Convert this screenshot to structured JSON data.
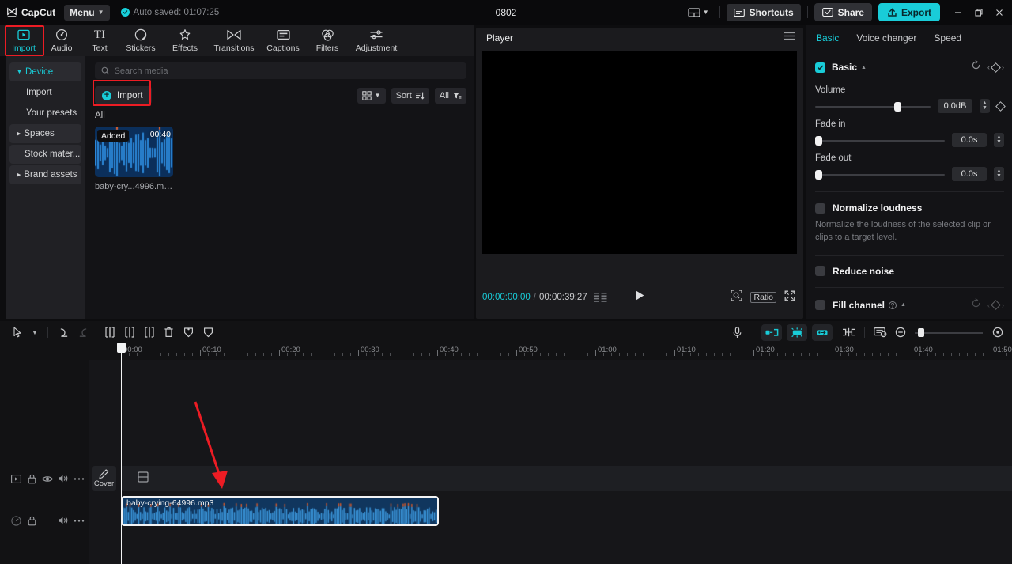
{
  "topbar": {
    "brand": "CapCut",
    "menu_label": "Menu",
    "autosave": "Auto saved: 01:07:25",
    "project_title": "0802",
    "shortcuts_label": "Shortcuts",
    "share_label": "Share",
    "export_label": "Export",
    "accent": "#19ccd8",
    "icons": {
      "layout": "layout-icon",
      "layout_caret": "chevron-down-icon",
      "shortcuts": "keyboard-icon",
      "share": "share-icon",
      "export": "upload-icon",
      "minimize": "minimize-icon",
      "maximize": "restore-icon",
      "close": "close-icon"
    }
  },
  "tabs": [
    {
      "label": "Import",
      "icon": "media-import-icon",
      "active": true
    },
    {
      "label": "Audio",
      "icon": "music-note-icon",
      "active": false
    },
    {
      "label": "Text",
      "icon": "text-icon",
      "active": false
    },
    {
      "label": "Stickers",
      "icon": "sticker-icon",
      "active": false
    },
    {
      "label": "Effects",
      "icon": "sparkle-icon",
      "active": false
    },
    {
      "label": "Transitions",
      "icon": "transition-icon",
      "active": false
    },
    {
      "label": "Captions",
      "icon": "caption-icon",
      "active": false
    },
    {
      "label": "Filters",
      "icon": "filters-icon",
      "active": false
    },
    {
      "label": "Adjustment",
      "icon": "adjustment-icon",
      "active": false
    }
  ],
  "leftnav": [
    {
      "label": "Device",
      "type": "group",
      "expanded": true,
      "active": true
    },
    {
      "label": "Import",
      "type": "sub",
      "active": false
    },
    {
      "label": "Your presets",
      "type": "sub",
      "active": false
    },
    {
      "label": "Spaces",
      "type": "group",
      "expanded": false,
      "active": false
    },
    {
      "label": "Stock mater...",
      "type": "plain",
      "active": false
    },
    {
      "label": "Brand assets",
      "type": "group",
      "expanded": false,
      "active": false
    }
  ],
  "media_panel": {
    "search_placeholder": "Search media",
    "search_value": "",
    "import_label": "Import",
    "view_chip": "grid-view",
    "sort_label": "Sort",
    "filter_label": "All",
    "all_label": "All",
    "items": [
      {
        "name": "baby-cry...4996.mp3",
        "badge": "Added",
        "duration": "00:40"
      }
    ]
  },
  "player": {
    "title": "Player",
    "current_time": "00:00:00:00",
    "separator": "/",
    "total_time": "00:00:39:27",
    "ratio_label": "Ratio",
    "icons": {
      "menu": "hamburger-icon",
      "quality": "quality-lines-icon",
      "play": "play-icon",
      "zoom_fit": "zoom-fit-icon",
      "fullscreen": "fullscreen-icon"
    }
  },
  "right_panel": {
    "tabs": [
      {
        "label": "Basic",
        "active": true
      },
      {
        "label": "Voice changer",
        "active": false
      },
      {
        "label": "Speed",
        "active": false
      }
    ],
    "basic": {
      "section_label": "Basic",
      "checked": true,
      "volume": {
        "label": "Volume",
        "value": "0.0dB",
        "percent": 73
      },
      "fade_in": {
        "label": "Fade in",
        "value": "0.0s",
        "percent": 0
      },
      "fade_out": {
        "label": "Fade out",
        "value": "0.0s",
        "percent": 0
      }
    },
    "normalize": {
      "label": "Normalize loudness",
      "checked": false,
      "desc": "Normalize the loudness of the selected clip or clips to a target level."
    },
    "reduce_noise": {
      "label": "Reduce noise",
      "checked": false
    },
    "fill_channel": {
      "label": "Fill channel",
      "checked": false
    }
  },
  "timeline": {
    "toolbar_left": [
      {
        "name": "select-tool-icon"
      },
      {
        "name": "tool-chevron-down-icon"
      },
      {
        "name": "undo-icon"
      },
      {
        "name": "redo-icon"
      },
      {
        "name": "split-icon"
      },
      {
        "name": "trim-left-icon"
      },
      {
        "name": "trim-right-icon"
      },
      {
        "name": "delete-icon"
      },
      {
        "name": "freeze-icon"
      },
      {
        "name": "mirror-icon"
      }
    ],
    "toolbar_right": [
      {
        "name": "microphone-icon"
      },
      {
        "name": "auto-cut-icon"
      },
      {
        "name": "auto-adjust-icon"
      },
      {
        "name": "speed-ramp-icon"
      },
      {
        "name": "add-transition-icon"
      },
      {
        "name": "snapshot-icon"
      },
      {
        "name": "zoom-out-icon"
      },
      {
        "name": "zoom-fit-timeline-icon"
      }
    ],
    "ruler_labels": [
      "00:00",
      "00:10",
      "00:20",
      "00:30",
      "00:40",
      "00:50",
      "01:00",
      "01:10",
      "01:20",
      "01:30",
      "01:40",
      "01:50"
    ],
    "cover_label": "Cover",
    "video_track_icons": [
      "video-track-icon",
      "lock-icon",
      "eye-icon",
      "speaker-icon",
      "more-icon"
    ],
    "audio_track_icons": [
      "audio-track-icon",
      "lock-icon",
      "speaker-icon",
      "more-icon"
    ],
    "clips": [
      {
        "name": "baby-crying-64996.mp3",
        "track": "audio",
        "selected": true
      }
    ],
    "playhead_time": "00:00"
  },
  "annotations": {
    "highlight_color": "#ec1c24",
    "boxes": [
      "import-tab-highlight",
      "import-button-highlight"
    ],
    "arrow": "red-arrow-pointing-to-audio-clip"
  }
}
